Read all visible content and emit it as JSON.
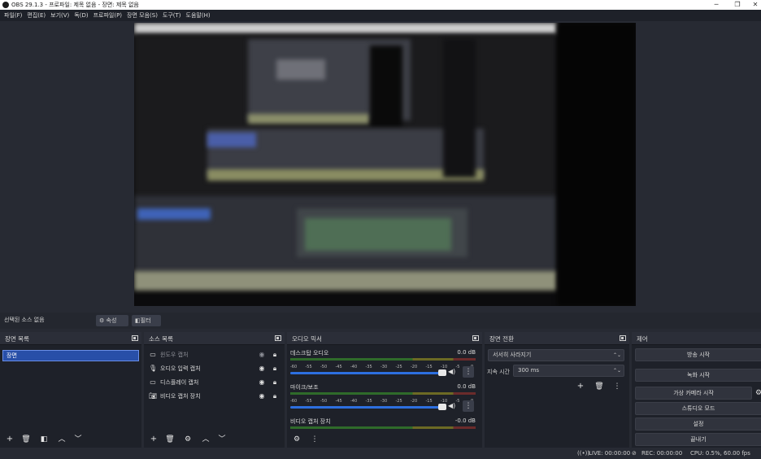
{
  "window": {
    "title": "OBS 29.1.3 - 프로파일: 제목 없음 - 장면: 제목 없음"
  },
  "menu": [
    "파일(F)",
    "편집(E)",
    "보기(V)",
    "독(D)",
    "프로파일(P)",
    "장면 모음(S)",
    "도구(T)",
    "도움말(H)"
  ],
  "source_toolbar": {
    "no_source": "선택된 소스 없음",
    "properties": "속성",
    "filters": "필터"
  },
  "scenes": {
    "title": "장면 목록",
    "items": [
      "장면"
    ]
  },
  "sources": {
    "title": "소스 목록",
    "items": [
      {
        "name": "윈도우 캡처",
        "icon": "window-icon"
      },
      {
        "name": "오디오 입력 캡처",
        "icon": "microphone-icon"
      },
      {
        "name": "디스플레이 캡처",
        "icon": "monitor-icon"
      },
      {
        "name": "비디오 캡처 장치",
        "icon": "camera-icon"
      }
    ]
  },
  "mixer": {
    "title": "오디오 믹서",
    "ticks": [
      "-60",
      "-55",
      "-50",
      "-45",
      "-40",
      "-35",
      "-30",
      "-25",
      "-20",
      "-15",
      "-10",
      "-5",
      "0"
    ],
    "channels": [
      {
        "name": "데스크탑 오디오",
        "db": "0.0 dB"
      },
      {
        "name": "마이크/보조",
        "db": "0.0 dB"
      },
      {
        "name": "비디오 캡처 장치",
        "db": "-0.0 dB"
      }
    ]
  },
  "transitions": {
    "title": "장면 전환",
    "selected": "서서히 사라지기",
    "duration_label": "지속 시간",
    "duration_value": "300 ms"
  },
  "controls": {
    "title": "제어",
    "buttons": [
      "방송 시작",
      "녹화 시작",
      "가상 카메라 시작",
      "스튜디오 모드",
      "설정",
      "끝내기"
    ]
  },
  "status": {
    "live": "LIVE: 00:00:00",
    "rec": "REC: 00:00:00",
    "cpu": "CPU: 0.5%, 60.00 fps"
  },
  "colors": {
    "background": "#272a33",
    "dock": "#1e2129",
    "accent": "#284fa8",
    "slider": "#2d6fe0"
  }
}
